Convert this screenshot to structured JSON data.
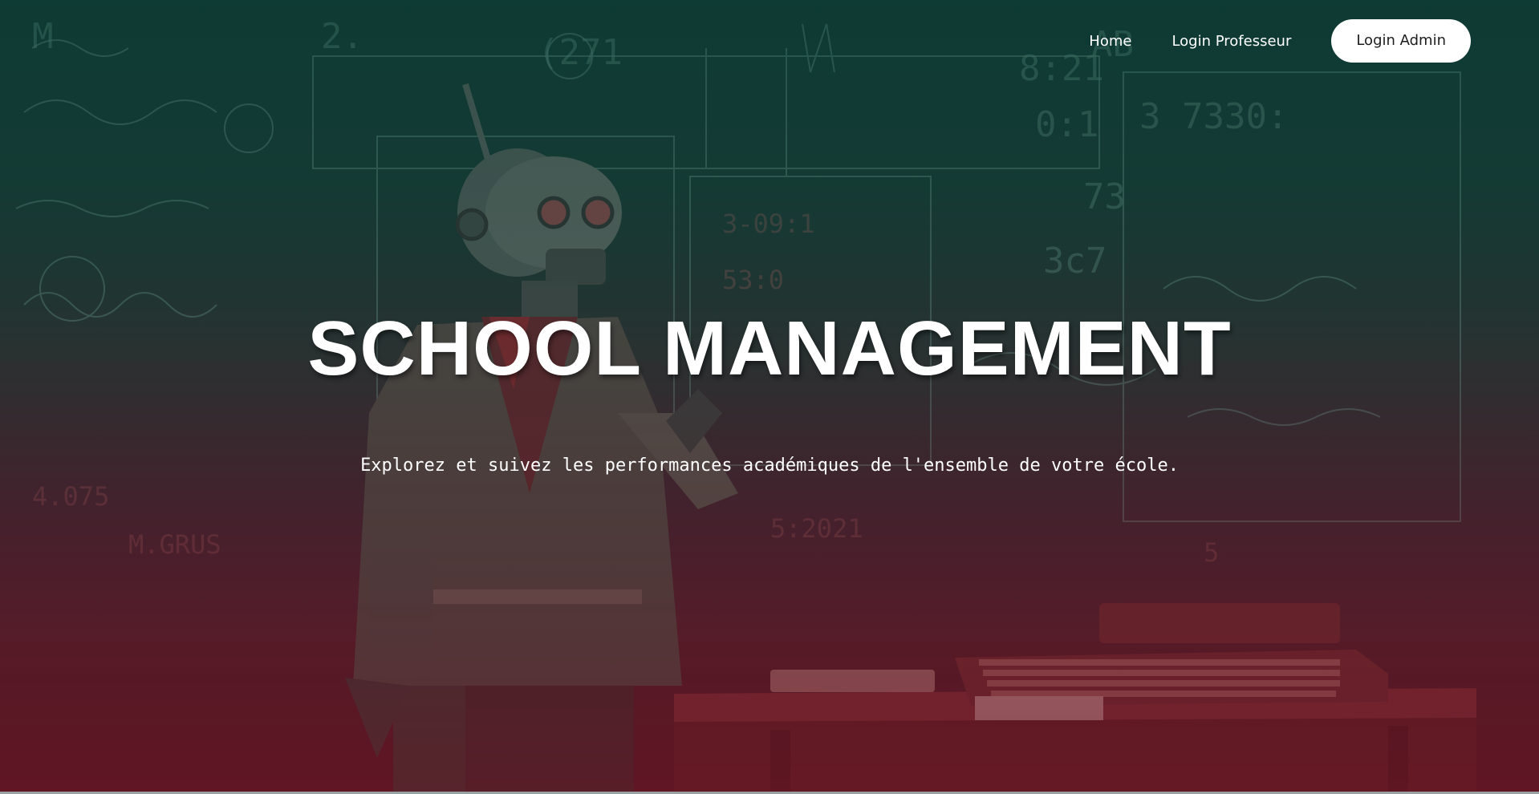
{
  "nav": {
    "home_label": "Home",
    "prof_label": "Login Professeur",
    "admin_label": "Login Admin"
  },
  "hero": {
    "title": "SCHOOL MANAGEMENT",
    "subtitle": "Explorez et suivez les performances académiques de l'ensemble de votre école."
  },
  "colors": {
    "top": "#103a34",
    "bottom": "#5a1a26",
    "button_bg": "#ffffff",
    "button_text": "#1d1d1d"
  }
}
